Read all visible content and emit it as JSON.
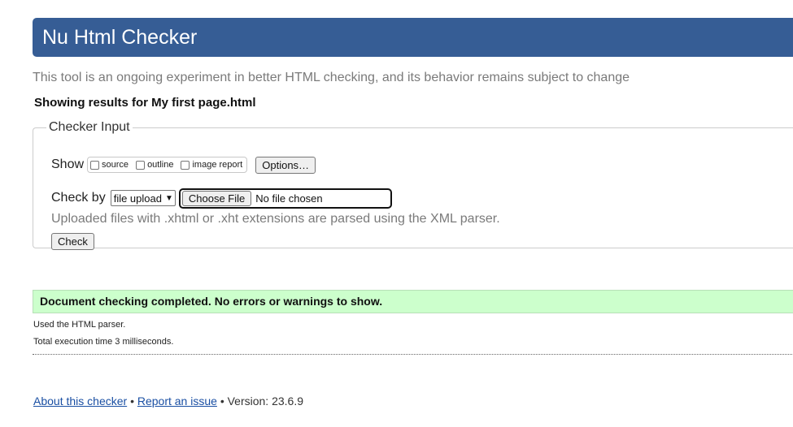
{
  "header": {
    "title": "Nu Html Checker"
  },
  "intro": "This tool is an ongoing experiment in better HTML checking, and its behavior remains subject to change",
  "results_for": "Showing results for My first page.html",
  "checker_input": {
    "legend": "Checker Input",
    "show_label": "Show",
    "show_options": [
      {
        "label": "source",
        "checked": false
      },
      {
        "label": "outline",
        "checked": false
      },
      {
        "label": "image report",
        "checked": false
      }
    ],
    "options_button": "Options…",
    "check_by_label": "Check by",
    "check_by_value": "file upload",
    "choose_file_button": "Choose File",
    "file_status": "No file chosen",
    "xml_note": "Uploaded files with .xhtml or .xht extensions are parsed using the XML parser.",
    "check_button": "Check"
  },
  "result": {
    "success_message": "Document checking completed. No errors or warnings to show.",
    "parser_note": "Used the HTML parser.",
    "exec_time": "Total execution time 3 milliseconds."
  },
  "footer": {
    "about_link": "About this checker",
    "sep1": "•",
    "report_link": "Report an issue",
    "sep2": "•",
    "version": "Version: 23.6.9"
  },
  "colors": {
    "header_bg": "#365d95",
    "success_bg": "#ccffcc",
    "link": "#1a4fa3"
  }
}
